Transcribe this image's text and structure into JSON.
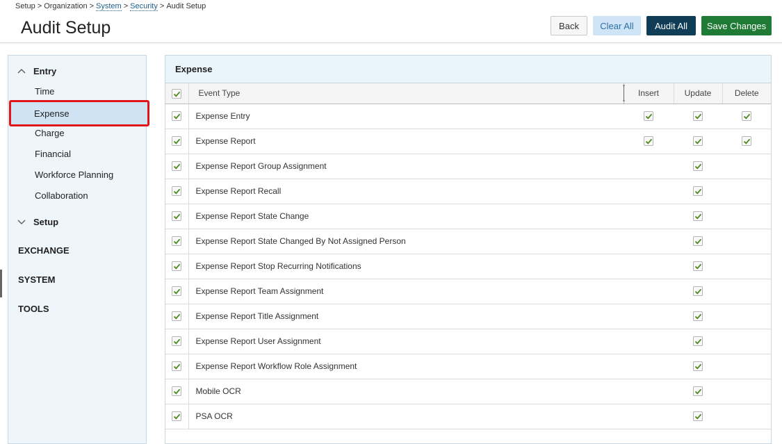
{
  "breadcrumb": {
    "setup": "Setup",
    "organization": "Organization",
    "system": "System",
    "security": "Security",
    "current": "Audit Setup",
    "separator": ">"
  },
  "header": {
    "title": "Audit Setup",
    "back_label": "Back",
    "clear_all_label": "Clear All",
    "audit_all_label": "Audit All",
    "save_label": "Save Changes"
  },
  "sidebar": {
    "entry": {
      "label": "Entry",
      "items": [
        "Time",
        "Expense",
        "Charge",
        "Financial",
        "Workforce Planning",
        "Collaboration"
      ],
      "selected": "Expense"
    },
    "setup": {
      "label": "Setup"
    },
    "sections": [
      "EXCHANGE",
      "SYSTEM",
      "TOOLS"
    ]
  },
  "panel": {
    "title": "Expense",
    "columns": {
      "event_type": "Event Type",
      "insert": "Insert",
      "update": "Update",
      "delete": "Delete"
    },
    "header_checkbox_checked": true,
    "rows": [
      {
        "name": "Expense Entry",
        "select": true,
        "insert": true,
        "update": true,
        "delete": true
      },
      {
        "name": "Expense Report",
        "select": true,
        "insert": true,
        "update": true,
        "delete": true
      },
      {
        "name": "Expense Report Group Assignment",
        "select": true,
        "insert": null,
        "update": true,
        "delete": null
      },
      {
        "name": "Expense Report Recall",
        "select": true,
        "insert": null,
        "update": true,
        "delete": null
      },
      {
        "name": "Expense Report State Change",
        "select": true,
        "insert": null,
        "update": true,
        "delete": null
      },
      {
        "name": "Expense Report State Changed By Not Assigned Person",
        "select": true,
        "insert": null,
        "update": true,
        "delete": null
      },
      {
        "name": "Expense Report Stop Recurring Notifications",
        "select": true,
        "insert": null,
        "update": true,
        "delete": null
      },
      {
        "name": "Expense Report Team Assignment",
        "select": true,
        "insert": null,
        "update": true,
        "delete": null
      },
      {
        "name": "Expense Report Title Assignment",
        "select": true,
        "insert": null,
        "update": true,
        "delete": null
      },
      {
        "name": "Expense Report User Assignment",
        "select": true,
        "insert": null,
        "update": true,
        "delete": null
      },
      {
        "name": "Expense Report Workflow Role Assignment",
        "select": true,
        "insert": null,
        "update": true,
        "delete": null
      },
      {
        "name": "Mobile OCR",
        "select": true,
        "insert": null,
        "update": true,
        "delete": null
      },
      {
        "name": "PSA OCR",
        "select": true,
        "insert": null,
        "update": true,
        "delete": null
      }
    ]
  },
  "colors": {
    "check": "#4a8a1c",
    "highlight_border": "#e0161c",
    "save_button": "#1f7a36",
    "audit_button": "#0f3d56",
    "clear_button": "#cfe4f6"
  },
  "icons": {
    "entry_chevron": "chevron-up-icon",
    "setup_chevron": "chevron-down-icon",
    "checkbox": "checkmark-icon"
  }
}
